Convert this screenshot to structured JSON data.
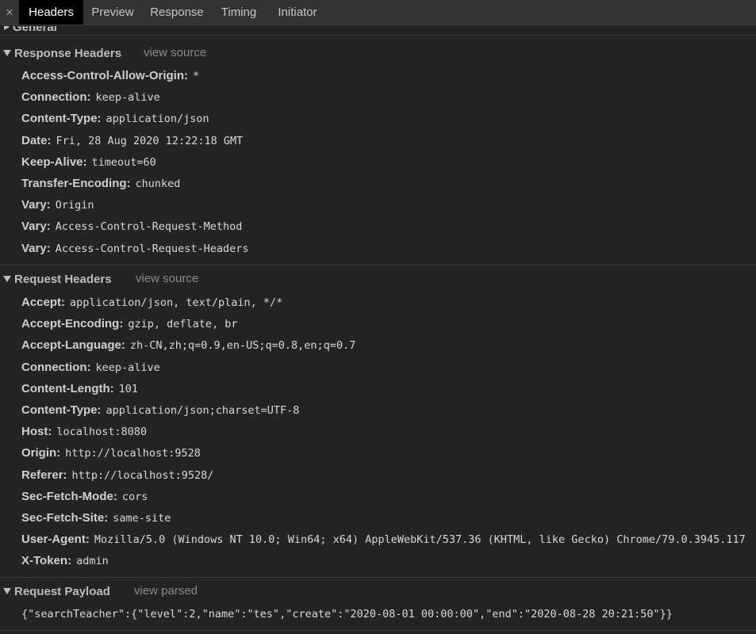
{
  "tabs": {
    "close": "×",
    "items": [
      "Headers",
      "Preview",
      "Response",
      "Timing",
      "Initiator"
    ]
  },
  "general": {
    "title": "General"
  },
  "response_headers": {
    "title": "Response Headers",
    "view_source": "view source",
    "rows": [
      {
        "key": "Access-Control-Allow-Origin",
        "value": "*"
      },
      {
        "key": "Connection",
        "value": "keep-alive"
      },
      {
        "key": "Content-Type",
        "value": "application/json"
      },
      {
        "key": "Date",
        "value": "Fri, 28 Aug 2020 12:22:18 GMT"
      },
      {
        "key": "Keep-Alive",
        "value": "timeout=60"
      },
      {
        "key": "Transfer-Encoding",
        "value": "chunked"
      },
      {
        "key": "Vary",
        "value": "Origin"
      },
      {
        "key": "Vary",
        "value": "Access-Control-Request-Method"
      },
      {
        "key": "Vary",
        "value": "Access-Control-Request-Headers"
      }
    ]
  },
  "request_headers": {
    "title": "Request Headers",
    "view_source": "view source",
    "rows": [
      {
        "key": "Accept",
        "value": "application/json, text/plain, */*"
      },
      {
        "key": "Accept-Encoding",
        "value": "gzip, deflate, br"
      },
      {
        "key": "Accept-Language",
        "value": "zh-CN,zh;q=0.9,en-US;q=0.8,en;q=0.7"
      },
      {
        "key": "Connection",
        "value": "keep-alive"
      },
      {
        "key": "Content-Length",
        "value": "101"
      },
      {
        "key": "Content-Type",
        "value": "application/json;charset=UTF-8"
      },
      {
        "key": "Host",
        "value": "localhost:8080"
      },
      {
        "key": "Origin",
        "value": "http://localhost:9528"
      },
      {
        "key": "Referer",
        "value": "http://localhost:9528/"
      },
      {
        "key": "Sec-Fetch-Mode",
        "value": "cors"
      },
      {
        "key": "Sec-Fetch-Site",
        "value": "same-site"
      },
      {
        "key": "User-Agent",
        "value": "Mozilla/5.0 (Windows NT 10.0; Win64; x64) AppleWebKit/537.36 (KHTML, like Gecko) Chrome/79.0.3945.117"
      },
      {
        "key": "X-Token",
        "value": "admin"
      }
    ]
  },
  "request_payload": {
    "title": "Request Payload",
    "view_parsed": "view parsed",
    "body": "{\"searchTeacher\":{\"level\":2,\"name\":\"tes\",\"create\":\"2020-08-01 00:00:00\",\"end\":\"2020-08-28 20:21:50\"}}"
  }
}
